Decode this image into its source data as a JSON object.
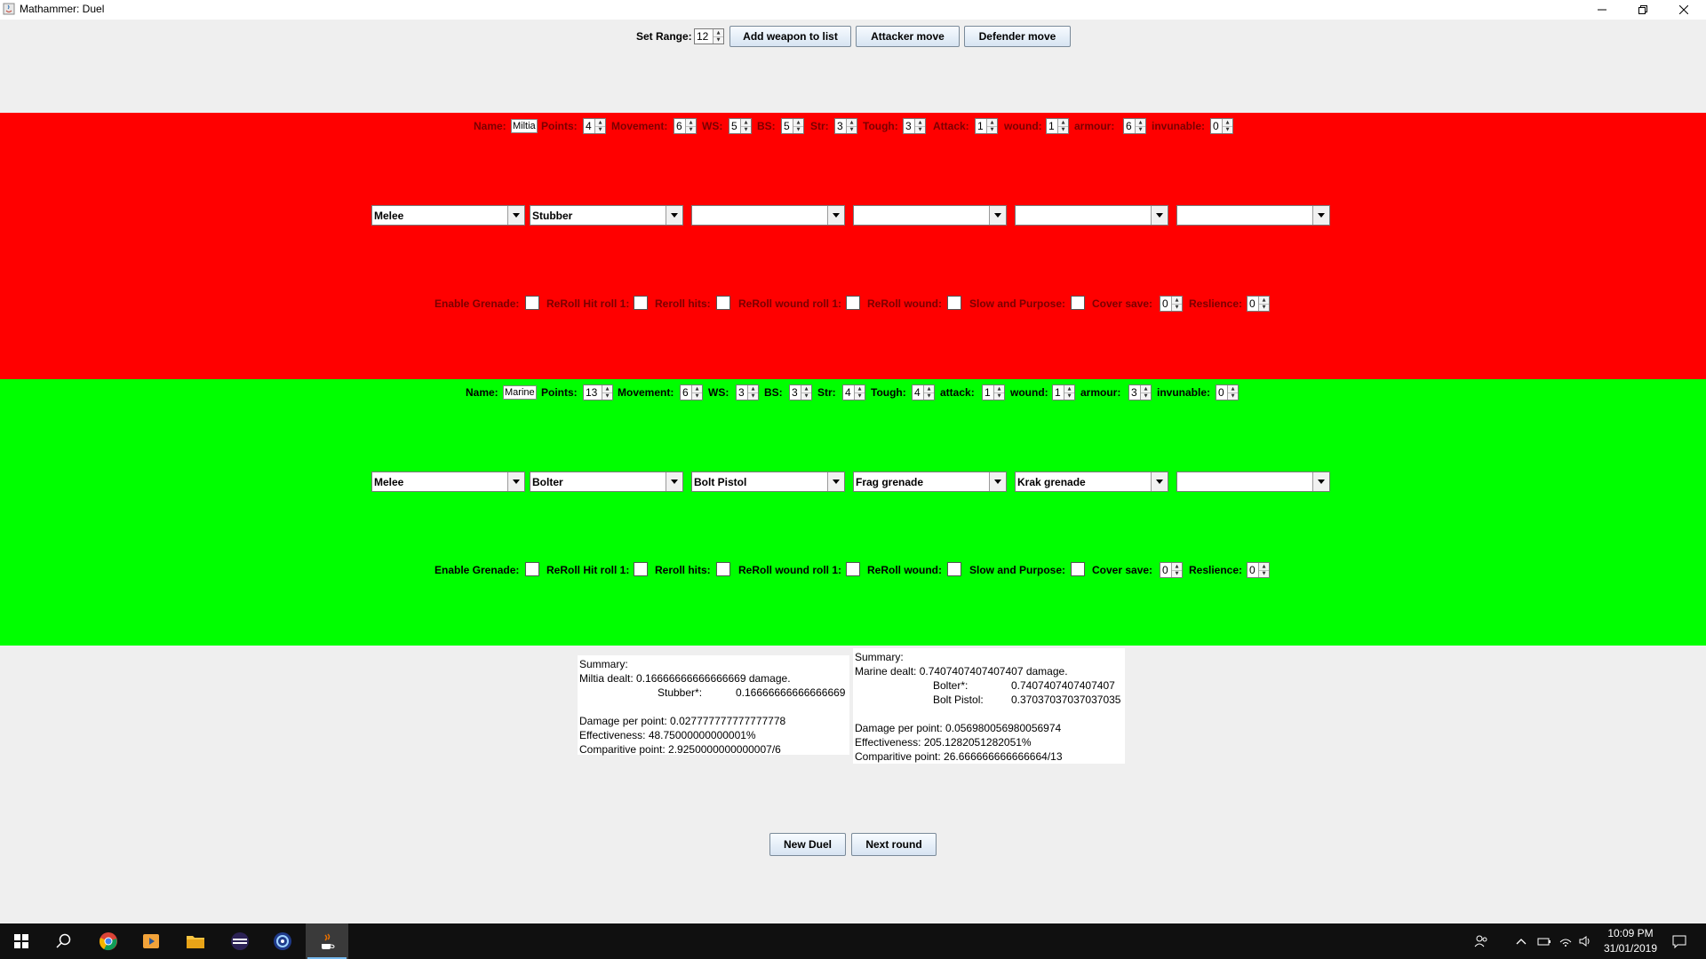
{
  "window": {
    "title": "Mathammer: Duel"
  },
  "toolbar": {
    "range_label": "Set Range:",
    "range_value": "12",
    "add_weapon_label": "Add weapon to list",
    "attacker_move_label": "Attacker move",
    "defender_move_label": "Defender move"
  },
  "attacker": {
    "color": "#ff0000",
    "stats": {
      "name_label": "Name:",
      "name": "Miltia",
      "points_label": "Points:",
      "points": "4",
      "movement_label": "Movement:",
      "movement": "6",
      "ws_label": "WS:",
      "ws": "5",
      "bs_label": "BS:",
      "bs": "5",
      "str_label": "Str:",
      "str": "3",
      "tough_label": "Tough:",
      "tough": "3",
      "attack_label": "Attack:",
      "attack": "1",
      "wound_label": "wound:",
      "wound": "1",
      "armour_label": "armour:",
      "armour": "6",
      "invunable_label": "invunable:",
      "invunable": "0"
    },
    "weapons": [
      "Melee",
      "Stubber",
      "",
      "",
      "",
      ""
    ],
    "options": {
      "enable_grenade_label": "Enable Grenade:",
      "reroll_hit_1_label": "ReRoll Hit roll 1:",
      "reroll_hits_label": "Reroll hits:",
      "reroll_wound_1_label": "ReRoll wound roll 1:",
      "reroll_wound_label": "ReRoll wound:",
      "slow_purpose_label": "Slow and Purpose:",
      "cover_save_label": "Cover save:",
      "cover_save": "0",
      "reslience_label": "Reslience:",
      "reslience": "0"
    }
  },
  "defender": {
    "color": "#00ff00",
    "stats": {
      "name_label": "Name:",
      "name": "Marine",
      "points_label": "Points:",
      "points": "13",
      "movement_label": "Movement:",
      "movement": "6",
      "ws_label": "WS:",
      "ws": "3",
      "bs_label": "BS:",
      "bs": "3",
      "str_label": "Str:",
      "str": "4",
      "tough_label": "Tough:",
      "tough": "4",
      "attack_label": "attack:",
      "attack": "1",
      "wound_label": "wound:",
      "wound": "1",
      "armour_label": "armour:",
      "armour": "3",
      "invunable_label": "invunable:",
      "invunable": "0"
    },
    "weapons": [
      "Melee",
      "Bolter",
      "Bolt Pistol",
      "Frag grenade",
      "Krak grenade",
      ""
    ],
    "options": {
      "enable_grenade_label": "Enable Grenade:",
      "reroll_hit_1_label": "ReRoll Hit roll 1:",
      "reroll_hits_label": "Reroll hits:",
      "reroll_wound_1_label": "ReRoll wound roll 1:",
      "reroll_wound_label": "ReRoll wound:",
      "slow_purpose_label": "Slow and Purpose:",
      "cover_save_label": "Cover save:",
      "cover_save": "0",
      "reslience_label": "Reslience:",
      "reslience": "0"
    }
  },
  "summary_left": {
    "heading": "Summary:",
    "dealt": "Miltia dealt: 0.16666666666666669 damage.",
    "weapon_name": "Stubber*:",
    "weapon_value": "0.16666666666666669",
    "damage_per_point": "Damage per point: 0.027777777777777778",
    "effectiveness": "Effectiveness: 48.75000000000001%",
    "comparitive": "Comparitive point: 2.9250000000000007/6"
  },
  "summary_right": {
    "heading": "Summary:",
    "dealt": "Marine dealt: 0.7407407407407407 damage.",
    "weapon1_name": "Bolter*:",
    "weapon1_value": "0.7407407407407407",
    "weapon2_name": "Bolt Pistol:",
    "weapon2_value": "0.37037037037037035",
    "damage_per_point": "Damage per point: 0.056980056980056974",
    "effectiveness": "Effectiveness: 205.1282051282051%",
    "comparitive": "Comparitive point: 26.666666666666664/13"
  },
  "actions": {
    "new_duel_label": "New Duel",
    "next_round_label": "Next round"
  },
  "taskbar": {
    "time": "10:09 PM",
    "date": "31/01/2019"
  }
}
